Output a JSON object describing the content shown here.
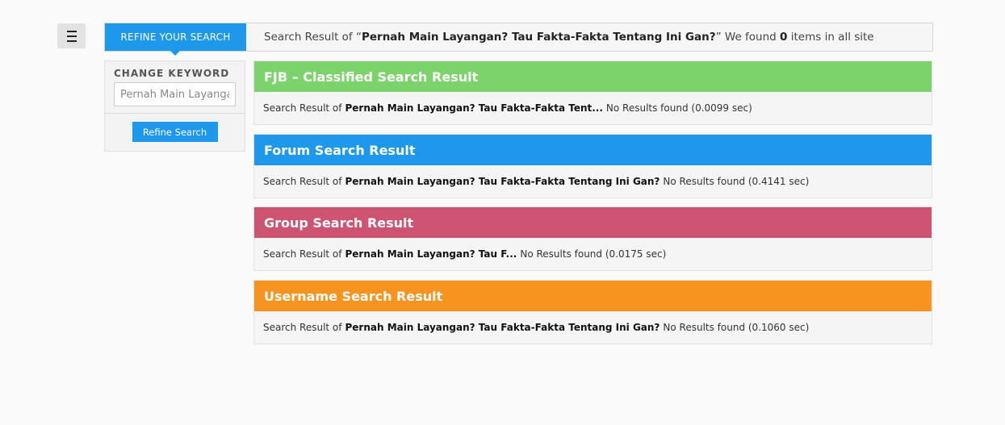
{
  "menu": {
    "icon": "hamburger-menu-icon"
  },
  "topbar": {
    "refine_tab_label": "REFINE YOUR SEARCH",
    "summary_prefix": "Search Result of “",
    "query": "Pernah Main Layangan? Tau Fakta-Fakta Tentang Ini Gan?",
    "summary_middle": "” We found ",
    "count": "0",
    "summary_suffix": " items in all site"
  },
  "sidebar": {
    "change_keyword_label": "CHANGE KEYWORD",
    "keyword_value": "Pernah Main Layangan? Tau Fakta-Fakta Tentang Ini Gan?",
    "refine_button_label": "Refine Search"
  },
  "results": [
    {
      "title": "FJB – Classified Search Result",
      "color": "#7dd36b",
      "prefix": "Search Result of",
      "query_shown": "Pernah Main Layangan? Tau Fakta-Fakta Tent...",
      "status": "No Results found (0.0099 sec)"
    },
    {
      "title": "Forum Search Result",
      "color": "#1e98ea",
      "prefix": "Search Result of",
      "query_shown": "Pernah Main Layangan? Tau Fakta-Fakta Tentang Ini Gan?",
      "status": "No Results found (0.4141 sec)"
    },
    {
      "title": "Group Search Result",
      "color": "#ce5272",
      "prefix": "Search Result of",
      "query_shown": "Pernah Main Layangan? Tau F...",
      "status": "No Results found (0.0175 sec)"
    },
    {
      "title": "Username Search Result",
      "color": "#f7941f",
      "prefix": "Search Result of",
      "query_shown": "Pernah Main Layangan? Tau Fakta-Fakta Tentang Ini Gan?",
      "status": "No Results found (0.1060 sec)"
    }
  ]
}
